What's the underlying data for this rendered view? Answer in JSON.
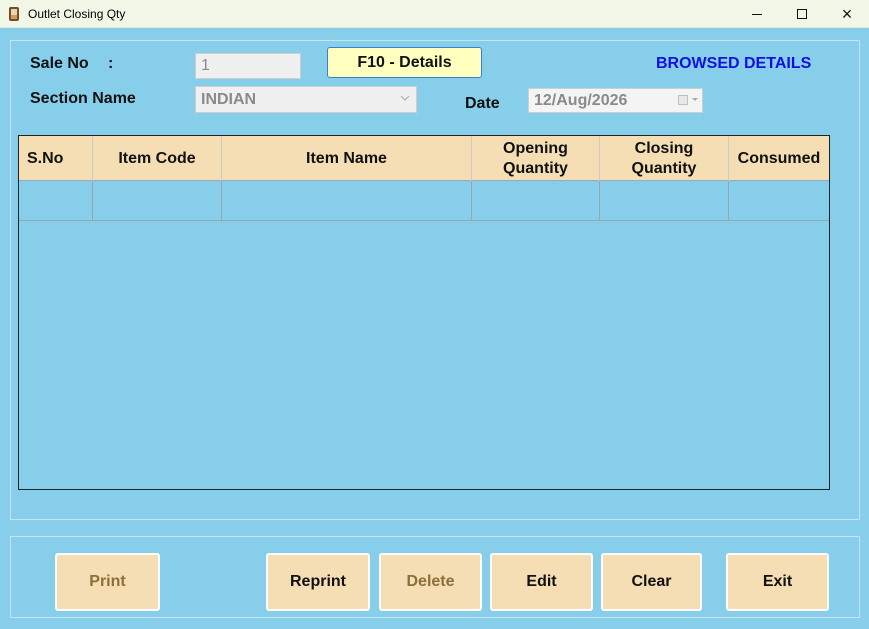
{
  "window": {
    "title": "Outlet Closing Qty",
    "icon": "app-icon",
    "controls": {
      "minimize": "minimize-icon",
      "maximize": "maximize-icon",
      "close": "×"
    }
  },
  "form": {
    "sale_no_label": "Sale No",
    "colon": ":",
    "sale_no_value": "1",
    "f10_button": "F10 - Details",
    "browsed_label": "BROWSED DETAILS",
    "section_label": "Section Name",
    "section_value": "INDIAN",
    "date_label": "Date",
    "date_value": "12/Aug/2026"
  },
  "grid": {
    "columns": [
      {
        "label": "S.No"
      },
      {
        "label": "Item Code"
      },
      {
        "label": "Item Name"
      },
      {
        "label": "Opening\nQuantity"
      },
      {
        "label": "Closing\nQuantity"
      },
      {
        "label": "Consumed"
      }
    ],
    "rows": [
      [
        "",
        "",
        "",
        "",
        "",
        ""
      ]
    ]
  },
  "buttons": {
    "print": "Print",
    "reprint": "Reprint",
    "delete": "Delete",
    "edit": "Edit",
    "clear": "Clear",
    "exit": "Exit"
  },
  "colors": {
    "background": "#87CEEB",
    "header": "#F5DEB3",
    "accent_text": "#1010E0",
    "f10_button": "#FFFFC0"
  }
}
